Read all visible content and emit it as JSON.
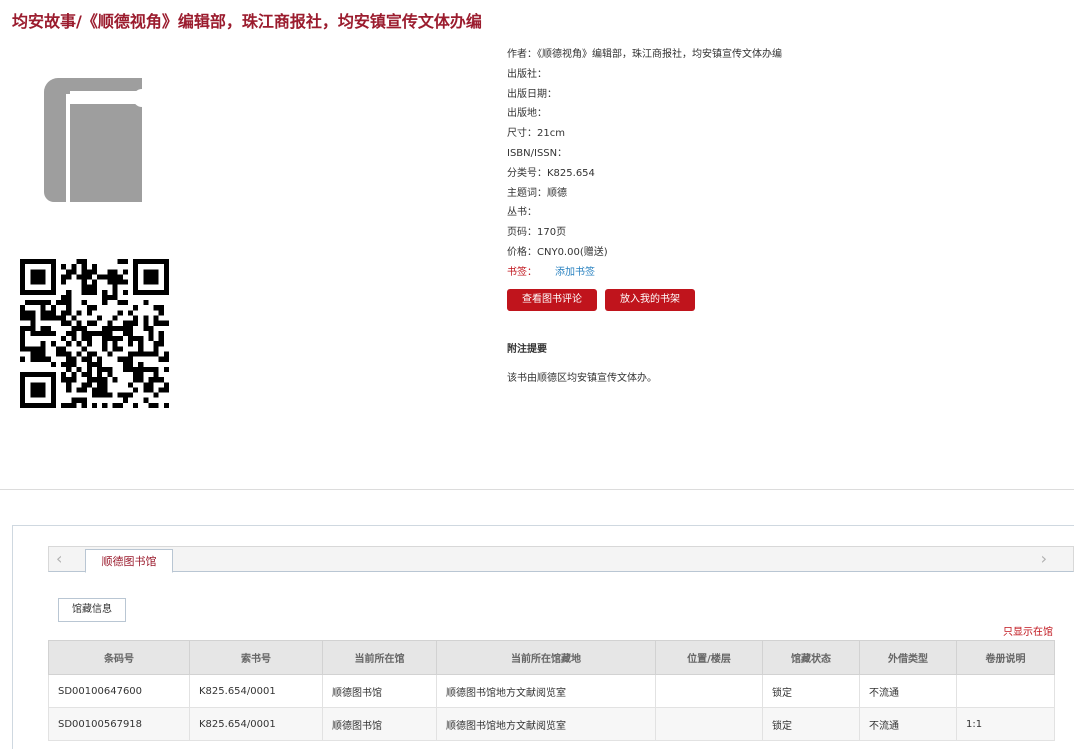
{
  "title": "均安故事/《顺德视角》编辑部，珠江商报社，均安镇宣传文体办编",
  "cover_icon": "book-icon",
  "qr_icon": "qr-code-icon",
  "meta": [
    {
      "key": "author",
      "text": "作者：《顺德视角》编辑部，珠江商报社，均安镇宣传文体办编"
    },
    {
      "key": "publisher",
      "text": "出版社："
    },
    {
      "key": "pubdate",
      "text": "出版日期："
    },
    {
      "key": "pubplace",
      "text": "出版地："
    },
    {
      "key": "size",
      "text": "尺寸：21cm"
    },
    {
      "key": "isbn",
      "text": "ISBN/ISSN："
    },
    {
      "key": "classno",
      "text": "分类号：K825.654"
    },
    {
      "key": "subject",
      "text": "主题词：顺德"
    },
    {
      "key": "series",
      "text": "丛书："
    },
    {
      "key": "pages",
      "text": "页码：170页"
    },
    {
      "key": "price",
      "text": "价格：CNY0.00(赠送)"
    }
  ],
  "tags": {
    "label": "书签：",
    "add_label": "添加书签"
  },
  "buttons": {
    "review": "查看图书评论",
    "shelf": "放入我的书架"
  },
  "note": {
    "heading": "附注提要",
    "text": "该书由顺德区均安镇宣传文体办。"
  },
  "library_tab": "顺德图书馆",
  "holdings_subtab": "馆藏信息",
  "only_here_link": "只显示在馆",
  "table": {
    "columns": [
      "条码号",
      "索书号",
      "当前所在馆",
      "当前所在馆藏地",
      "位置/楼层",
      "馆藏状态",
      "外借类型",
      "卷册说明"
    ],
    "rows": [
      [
        "SD00100647600",
        "K825.654/0001",
        "顺德图书馆",
        "顺德图书馆地方文献阅览室",
        "",
        "锁定",
        "不流通",
        ""
      ],
      [
        "SD00100567918",
        "K825.654/0001",
        "顺德图书馆",
        "顺德图书馆地方文献阅览室",
        "",
        "锁定",
        "不流通",
        "1:1"
      ]
    ]
  },
  "colors": {
    "accent": "#c0141c",
    "title": "#9b1c2e",
    "link": "#2a82c0"
  }
}
